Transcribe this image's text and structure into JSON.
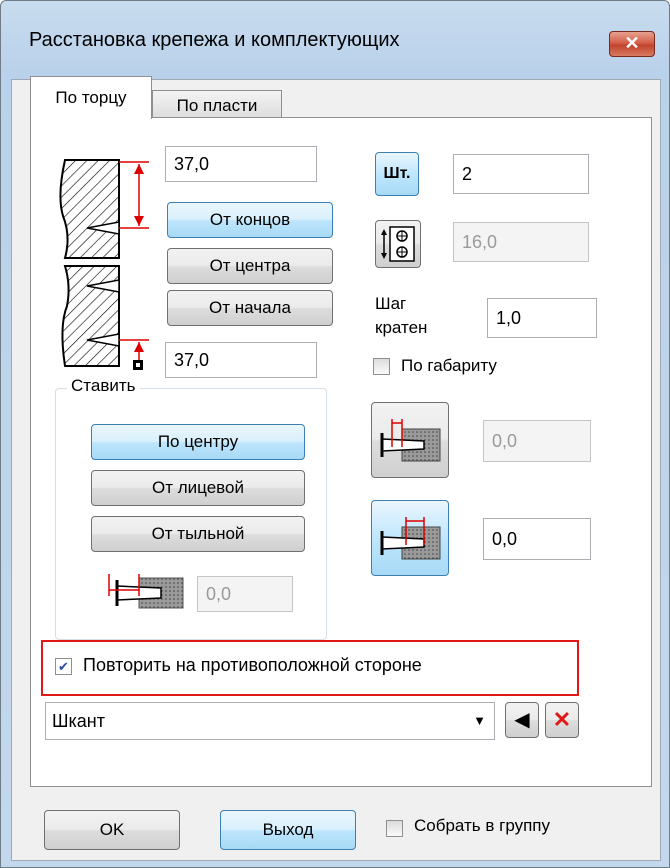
{
  "window": {
    "title": "Расстановка крепежа и комплектующих",
    "close_glyph": "✕"
  },
  "tabs": [
    {
      "label": "По торцу"
    },
    {
      "label": "По пласти"
    }
  ],
  "left": {
    "top_value": "37,0",
    "bottom_value": "37,0",
    "btn_from_ends": "От концов",
    "btn_from_center": "От центра",
    "btn_from_start": "От начала"
  },
  "place_group": {
    "label": "Ставить",
    "btn_center": "По центру",
    "btn_face": "От лицевой",
    "btn_back": "От тыльной",
    "offset_value": "0,0"
  },
  "right": {
    "count_button": "Шт.",
    "count_value": "2",
    "step_value": "16,0",
    "step_label_line1": "Шаг",
    "step_label_line2": "кратен",
    "multiple_value": "1,0",
    "by_size_label": "По габариту",
    "depth1_value": "0,0",
    "depth2_value": "0,0"
  },
  "repeat_checkbox": {
    "label": "Повторить на противоположной стороне",
    "checked": true,
    "check_glyph": "✔"
  },
  "fastener": {
    "value": "Шкант",
    "arrow_glyph": "▼",
    "pick_glyph": "◀",
    "delete_glyph": "✕"
  },
  "footer": {
    "ok": "OK",
    "exit": "Выход",
    "group_label": "Собрать в группу"
  },
  "colors": {
    "accent_red": "#e01818",
    "selected_blue": "#bee6fd"
  }
}
